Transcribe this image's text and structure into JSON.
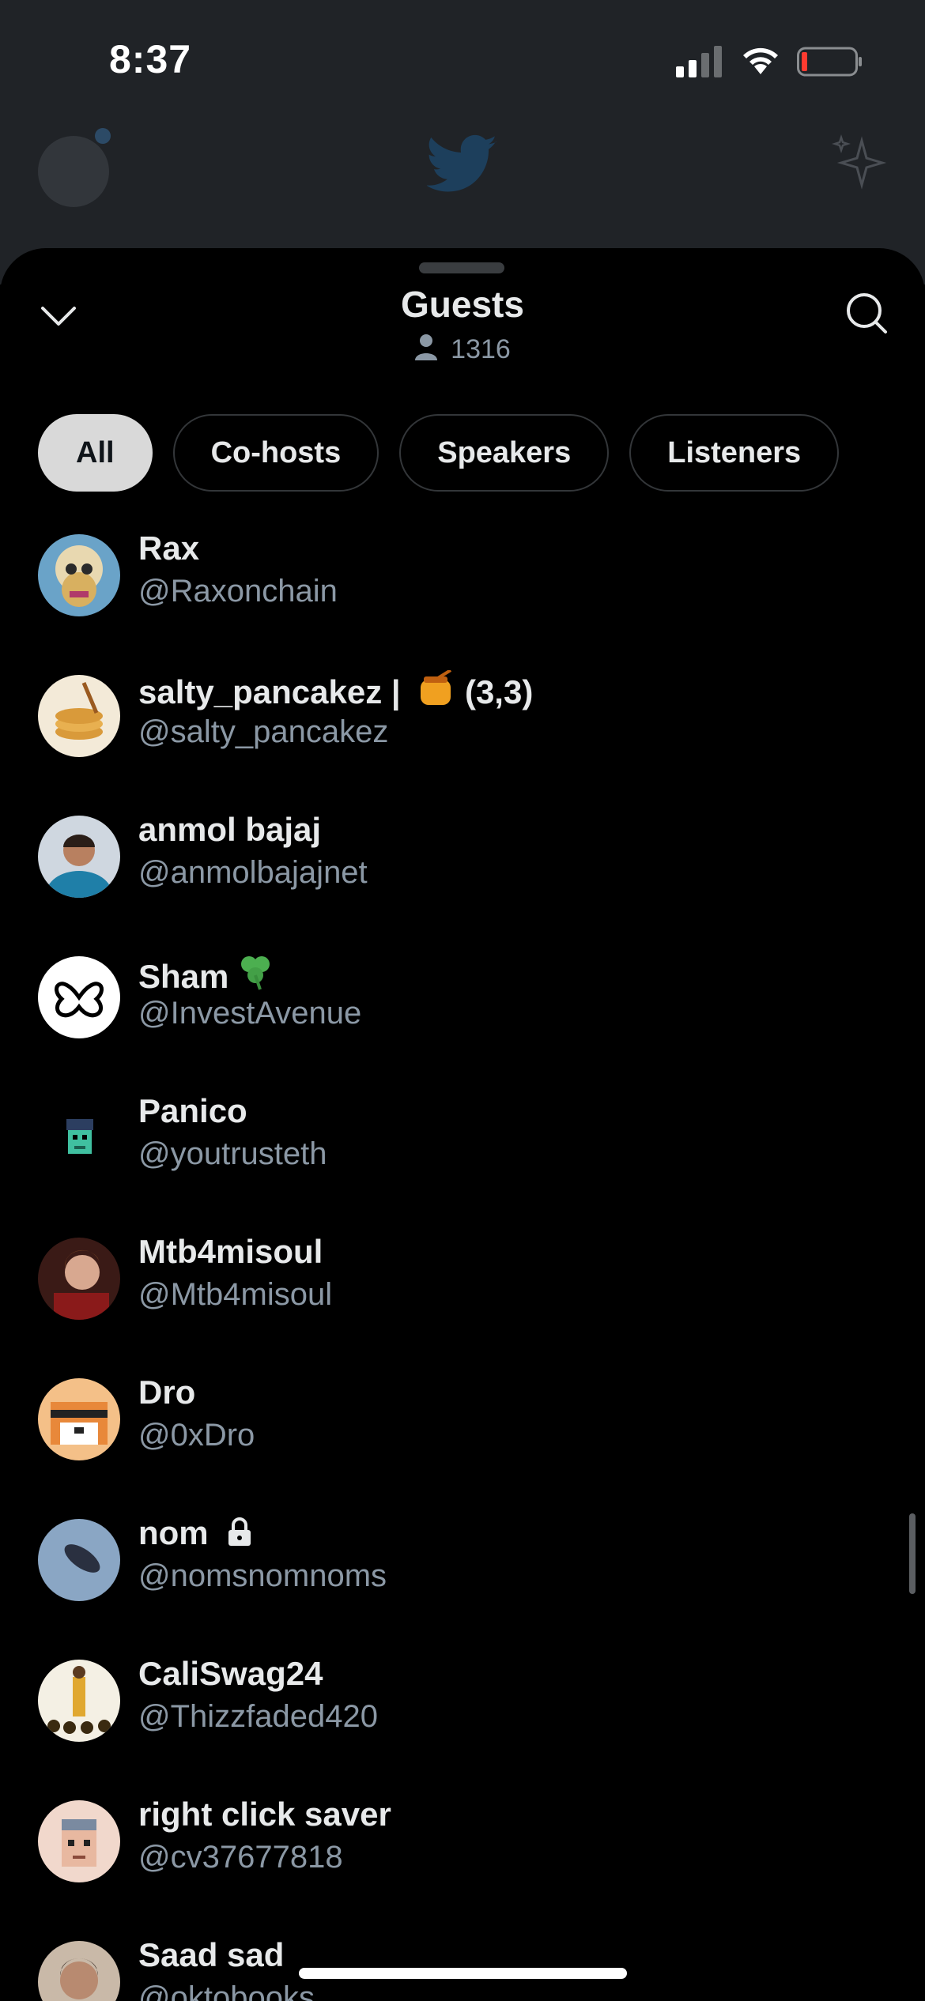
{
  "status_bar": {
    "time": "8:37"
  },
  "sheet": {
    "title": "Guests",
    "guest_count": "1316"
  },
  "filters": [
    {
      "label": "All",
      "active": true
    },
    {
      "label": "Co-hosts",
      "active": false
    },
    {
      "label": "Speakers",
      "active": false
    },
    {
      "label": "Listeners",
      "active": false
    }
  ],
  "guests": [
    {
      "name": "Rax",
      "handle": "@Raxonchain",
      "badge": "",
      "avatar_color": "#6aa3c8"
    },
    {
      "name": "salty_pancakez | ",
      "handle": "@salty_pancakez",
      "badge": "honey-pot-emoji",
      "badge_text": "(3,3)",
      "avatar_color": "#f3ead8"
    },
    {
      "name": "anmol bajaj",
      "handle": "@anmolbajajnet",
      "badge": "",
      "avatar_color": "#3d7fb8"
    },
    {
      "name": "Sham",
      "handle": "@InvestAvenue",
      "badge": "shamrock-emoji",
      "avatar_color": "#ffffff"
    },
    {
      "name": "Panico",
      "handle": "@youtrusteth",
      "badge": "",
      "avatar_color": "#000000"
    },
    {
      "name": "Mtb4misoul",
      "handle": "@Mtb4misoul",
      "badge": "",
      "avatar_color": "#5a2a22"
    },
    {
      "name": "Dro",
      "handle": "@0xDro",
      "badge": "",
      "avatar_color": "#f0a050"
    },
    {
      "name": "nom",
      "handle": "@nomsnomnoms",
      "badge": "lock-icon",
      "avatar_color": "#8aa6c4"
    },
    {
      "name": "CaliSwag24",
      "handle": "@Thizzfaded420",
      "badge": "",
      "avatar_color": "#f4f0e4"
    },
    {
      "name": "right click saver",
      "handle": "@cv37677818",
      "badge": "",
      "avatar_color": "#f1d8cc"
    },
    {
      "name": "Saad sad",
      "handle": "@oktobooks",
      "badge": "",
      "avatar_color": "#c9b9a8"
    }
  ]
}
